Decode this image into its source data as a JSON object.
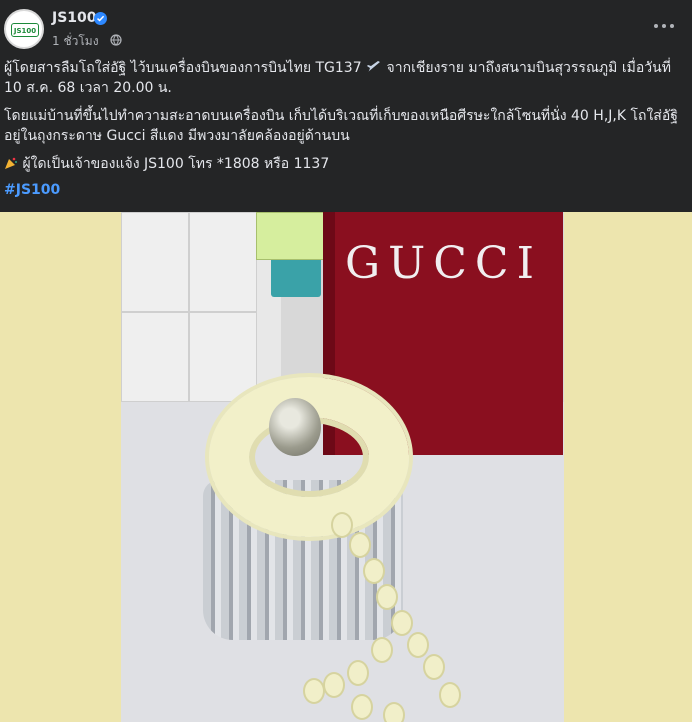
{
  "header": {
    "page_name": "JS100",
    "time": "1 ชั่วโมง",
    "avatar_logo": "JS100"
  },
  "post": {
    "paragraph1": "ผู้โดยสารลืมโถใส่อัฐิ ไว้บนเครื่องบินของการบินไทย TG137",
    "paragraph1_tail": " จากเชียงราย มาถึงสนามบินสุวรรณภูมิ เมื่อวันที่ 10 ส.ค. 68 เวลา 20.00 น.",
    "paragraph2": "โดยแม่บ้านที่ขึ้นไปทำความสะอาดบนเครื่องบิน เก็บได้บริเวณที่เก็บของเหนือศีรษะใกล้โซนที่นั่ง 40 H,J,K โถใส่อัฐิอยู่ในถุงกระดาษ Gucci สีแดง มีพวงมาลัยคล้องอยู่ด้านบน",
    "paragraph3": "ผู้ใดเป็นเจ้าของแจ้ง JS100 โทร *1808 หรือ 1137",
    "hashtag": "#JS100"
  },
  "photo": {
    "bag_brand": "GUCCI"
  },
  "colors": {
    "background": "#242526",
    "text": "#e4e6eb",
    "secondary_text": "#b0b3b8",
    "hashtag": "#4b9bff",
    "verified": "#2d88ff",
    "media_background": "#ede5ae",
    "bag_red": "#8a0f1f"
  },
  "icons": [
    "avatar",
    "verified-badge-icon",
    "globe-icon",
    "more-options-icon",
    "airplane-emoji-icon",
    "party-popper-emoji-icon"
  ]
}
